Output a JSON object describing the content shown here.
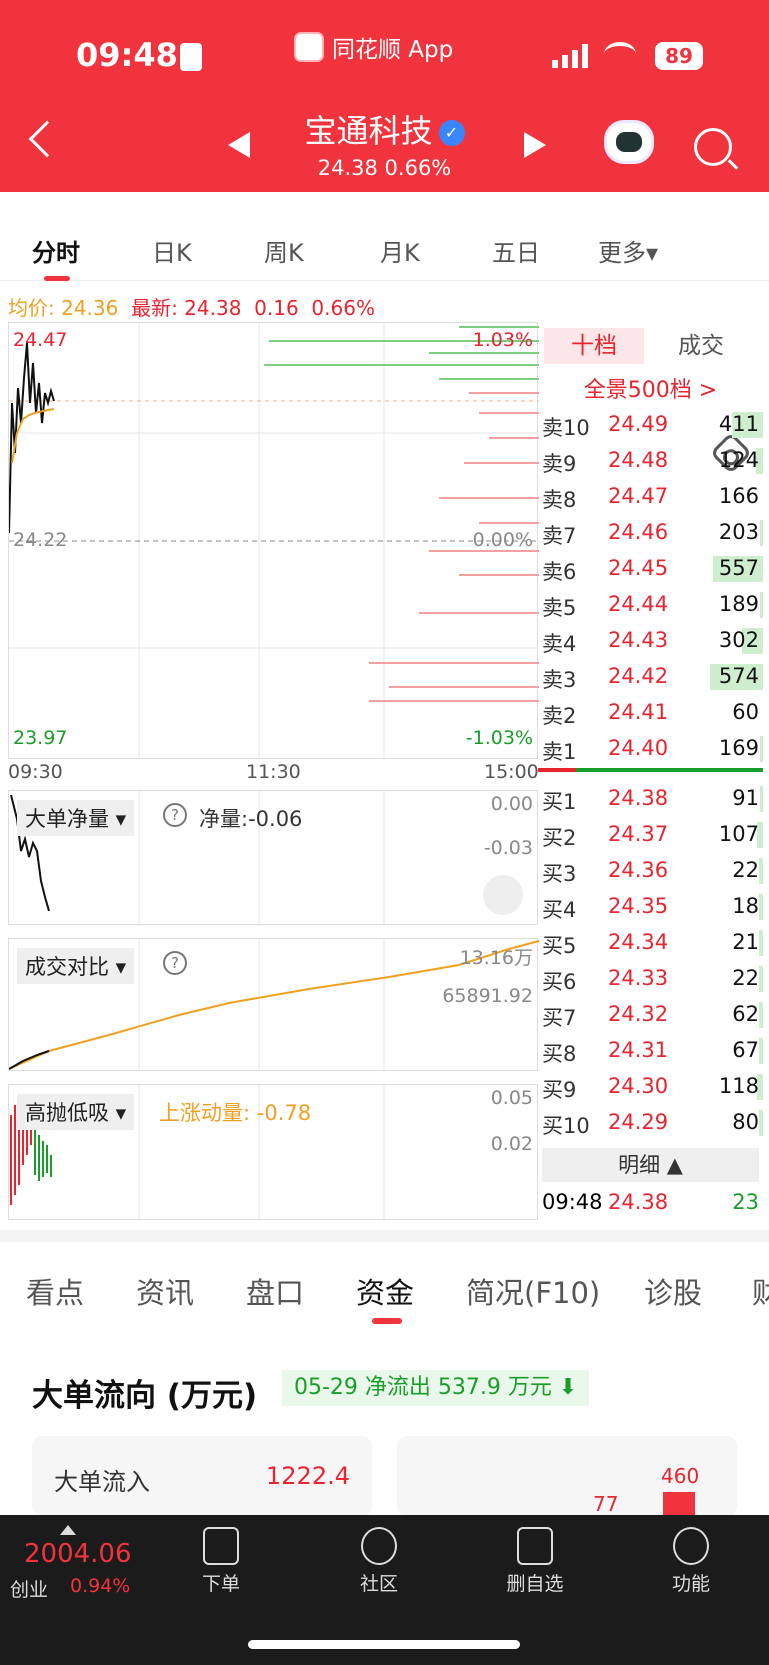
{
  "status": {
    "time": "09:48",
    "app": "同花顺 App",
    "battery": "89"
  },
  "header": {
    "title": "宝通科技",
    "price": "24.38",
    "change_pct": "0.66%"
  },
  "tabs": [
    {
      "label": "分时"
    },
    {
      "label": "日K"
    },
    {
      "label": "周K"
    },
    {
      "label": "月K"
    },
    {
      "label": "五日"
    },
    {
      "label": "更多▾"
    }
  ],
  "info": {
    "avg_label": "均价: 24.36",
    "latest_label": "最新: 24.38",
    "change": "0.16",
    "pct": "0.66%"
  },
  "chart_main": {
    "high": "24.47",
    "mid": "24.22",
    "low": "23.97",
    "pct_high": "1.03%",
    "pct_mid": "0.00%",
    "pct_low": "-1.03%",
    "time_start": "09:30",
    "time_mid": "11:30",
    "time_end": "15:00"
  },
  "sub1": {
    "label": "大单净量 ▾",
    "qmark": "?",
    "value": "净量:-0.06",
    "top": "0.00",
    "second": "-0.03"
  },
  "sub2": {
    "label": "成交对比 ▾",
    "qmark": "?",
    "top": "13.16万",
    "second": "65891.92"
  },
  "sub3": {
    "label": "高抛低吸 ▾",
    "value": "上涨动量: -0.78",
    "top": "0.05",
    "second": "0.02"
  },
  "orderbook": {
    "tab_active": "十档",
    "tab_other": "成交",
    "all_levels": "全景500档 >",
    "asks": [
      {
        "label": "卖10",
        "price": "24.49",
        "volume": "411",
        "level": 0.22
      },
      {
        "label": "卖9",
        "price": "24.48",
        "volume": "124",
        "level": 0.05
      },
      {
        "label": "卖8",
        "price": "24.47",
        "volume": "166",
        "level": 0.0
      },
      {
        "label": "卖7",
        "price": "24.46",
        "volume": "203",
        "level": 0.02
      },
      {
        "label": "卖6",
        "price": "24.45",
        "volume": "557",
        "level": 0.36
      },
      {
        "label": "卖5",
        "price": "24.44",
        "volume": "189",
        "level": 0.02
      },
      {
        "label": "卖4",
        "price": "24.43",
        "volume": "302",
        "level": 0.15
      },
      {
        "label": "卖3",
        "price": "24.42",
        "volume": "574",
        "level": 0.38
      },
      {
        "label": "卖2",
        "price": "24.41",
        "volume": "60",
        "level": 0.0
      },
      {
        "label": "卖1",
        "price": "24.40",
        "volume": "169",
        "level": 0.02
      }
    ],
    "bids": [
      {
        "label": "买1",
        "price": "24.38",
        "volume": "91",
        "level": 0.02
      },
      {
        "label": "买2",
        "price": "24.37",
        "volume": "107",
        "level": 0.04
      },
      {
        "label": "买3",
        "price": "24.36",
        "volume": "22",
        "level": 0.03
      },
      {
        "label": "买4",
        "price": "24.35",
        "volume": "18",
        "level": 0.03
      },
      {
        "label": "买5",
        "price": "24.34",
        "volume": "21",
        "level": 0.03
      },
      {
        "label": "买6",
        "price": "24.33",
        "volume": "22",
        "level": 0.03
      },
      {
        "label": "买7",
        "price": "24.32",
        "volume": "62",
        "level": 0.03
      },
      {
        "label": "买8",
        "price": "24.31",
        "volume": "67",
        "level": 0.03
      },
      {
        "label": "买9",
        "price": "24.30",
        "volume": "118",
        "level": 0.04
      },
      {
        "label": "买10",
        "price": "24.29",
        "volume": "80",
        "level": 0.03
      }
    ],
    "detail_label": "明细 ▲",
    "last_trade": {
      "time": "09:48",
      "price": "24.38",
      "volume": "23"
    }
  },
  "bottom_tabs": [
    {
      "label": "看点"
    },
    {
      "label": "资讯"
    },
    {
      "label": "盘口"
    },
    {
      "label": "资金"
    },
    {
      "label": "简况(F10)"
    },
    {
      "label": "诊股"
    },
    {
      "label": "财"
    }
  ],
  "capital": {
    "title": "大单流向 (万元)",
    "net": "05-29 净流出 537.9 万元 ⬇",
    "inflow_label": "大单流入",
    "inflow_value": "1222.4",
    "bar_a": "460",
    "bar_b": "77"
  },
  "bottom_bar": {
    "index_value": "2004.06",
    "index_name": "创业",
    "index_pct": "0.94%",
    "items": [
      {
        "label": "下单"
      },
      {
        "label": "社区"
      },
      {
        "label": "删自选"
      },
      {
        "label": "功能"
      }
    ]
  },
  "colors": {
    "brand": "#f1333d",
    "up": "#e8242f",
    "down": "#1a9e2a",
    "avg_line": "#f0a020"
  }
}
